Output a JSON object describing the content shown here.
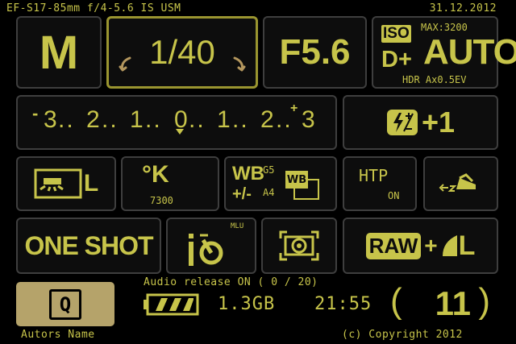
{
  "header": {
    "lens": "EF-S17-85mm f/4-5.6 IS USM",
    "date": "31.12.2012"
  },
  "mode": {
    "label": "M"
  },
  "shutter": {
    "value": "1/40"
  },
  "aperture": {
    "value": "F5.6"
  },
  "iso": {
    "badge": "ISO",
    "max": "MAX:3200",
    "value": "AUTO",
    "dplus": "D+",
    "hdr": "HDR Ax0.5EV"
  },
  "exposure_scale": {
    "left_sign": "-",
    "items": [
      "3",
      "2",
      "1",
      "0",
      "1",
      "2",
      "3"
    ],
    "right_sign": "+"
  },
  "flash_comp": {
    "icon": "flash-exposure-comp-icon",
    "value": "+1"
  },
  "white_balance_mode": {
    "icon": "white-balance-fluorescent-icon",
    "label": "L"
  },
  "kelvin": {
    "symbol": "°K",
    "value": "7300"
  },
  "wb_shift": {
    "wb": "WB",
    "pm": "+/-",
    "g": "G5",
    "a": "A4",
    "bracket": "WB"
  },
  "htp": {
    "label": "HTP",
    "state": "ON"
  },
  "drive_mode": {
    "icon": "ae-lock-icon"
  },
  "af_mode": {
    "label": "ONE SHOT"
  },
  "timer": {
    "mlu": "MLU",
    "icon": "self-timer-icon"
  },
  "metering": {
    "icon": "evaluative-metering-icon"
  },
  "quality": {
    "raw": "RAW",
    "plus": "+",
    "size": "L"
  },
  "footer": {
    "q_label": "Q",
    "author": "Autors Name",
    "audio": "Audio release ON ( 0 / 20)",
    "storage": "1.3GB",
    "time": "21:55",
    "shots": "11",
    "copyright": "(c) Copyright 2012"
  },
  "colors": {
    "text": "#c7c44a",
    "panel_border": "#3e3e3e",
    "selected_border": "#9a9530",
    "q_fill": "#b5a36a"
  }
}
